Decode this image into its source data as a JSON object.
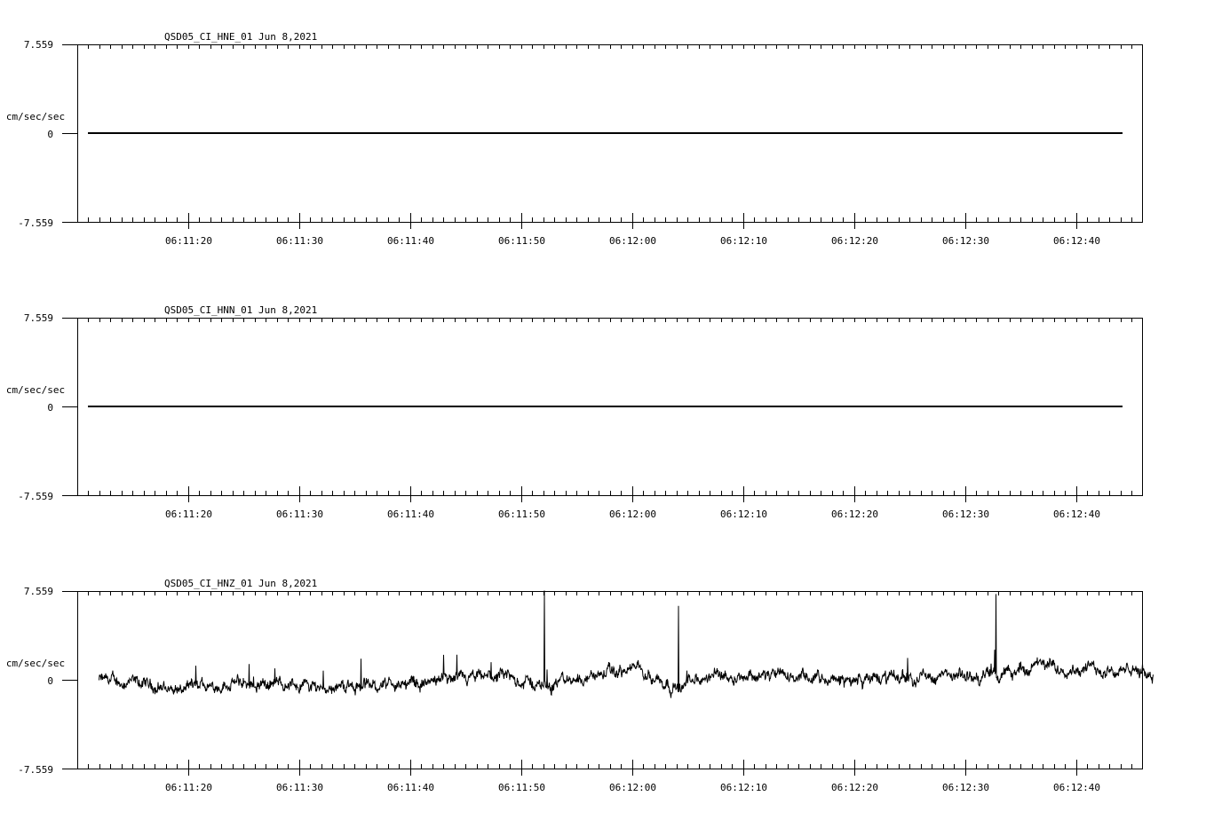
{
  "time_axis": {
    "tick_labels": [
      "06:11:20",
      "06:11:30",
      "06:11:40",
      "06:11:50",
      "06:12:00",
      "06:12:10",
      "06:12:20",
      "06:12:30",
      "06:12:40"
    ],
    "start_seconds": 11,
    "end_seconds": 107
  },
  "chart_data": [
    {
      "type": "line",
      "title": "QSD05_CI_HNE_01  Jun 8,2021",
      "ylabel": "cm/sec/sec",
      "y_tick_labels": [
        "7.559",
        "0",
        "-7.559"
      ],
      "ylim": [
        -7.559,
        7.559
      ],
      "series": [
        {
          "kind": "flat",
          "value": 0
        }
      ]
    },
    {
      "type": "line",
      "title": "QSD05_CI_HNN_01  Jun 8,2021",
      "ylabel": "cm/sec/sec",
      "y_tick_labels": [
        "7.559",
        "0",
        "-7.559"
      ],
      "ylim": [
        -7.559,
        7.559
      ],
      "series": [
        {
          "kind": "flat",
          "value": 0
        }
      ]
    },
    {
      "type": "line",
      "title": "QSD05_CI_HNZ_01  Jun 8,2021",
      "ylabel": "cm/sec/sec",
      "y_tick_labels": [
        "7.559",
        "0",
        "-7.559"
      ],
      "ylim": [
        -7.559,
        7.559
      ],
      "series": [
        {
          "kind": "trend",
          "trend_points": [
            [
              12,
              0.0
            ],
            [
              16,
              -0.4
            ],
            [
              19.5,
              -0.9
            ],
            [
              24,
              -0.3
            ],
            [
              28,
              -0.3
            ],
            [
              33,
              -0.6
            ],
            [
              38,
              -0.4
            ],
            [
              43,
              -0.2
            ],
            [
              48,
              0.3
            ],
            [
              52,
              -0.5
            ],
            [
              55,
              0.1
            ],
            [
              57,
              0.4
            ],
            [
              59,
              0.7
            ],
            [
              61,
              1.0
            ],
            [
              62,
              0.2
            ],
            [
              64,
              -0.6
            ],
            [
              66,
              -0.1
            ],
            [
              68,
              0.5
            ],
            [
              74,
              0.3
            ],
            [
              78,
              -0.1
            ],
            [
              82,
              0.1
            ],
            [
              86,
              0.3
            ],
            [
              90,
              0.2
            ],
            [
              94,
              0.5
            ],
            [
              96,
              1.2
            ],
            [
              100,
              1.0
            ],
            [
              104,
              0.8
            ],
            [
              107,
              0.5
            ]
          ],
          "spikes": [
            [
              52.1,
              7.6
            ],
            [
              64.2,
              6.3
            ],
            [
              92.8,
              7.3
            ],
            [
              20.7,
              1.2
            ],
            [
              47.3,
              1.5
            ],
            [
              35.6,
              1.8
            ]
          ]
        }
      ]
    }
  ]
}
